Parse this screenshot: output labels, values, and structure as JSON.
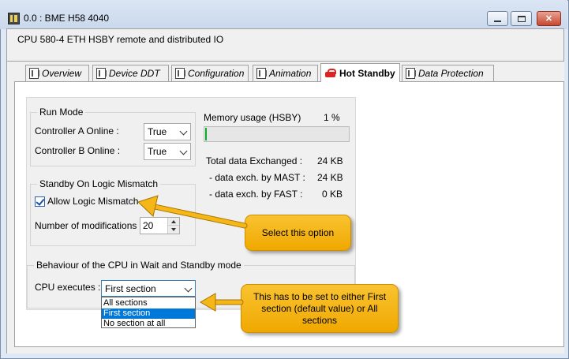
{
  "window": {
    "title": "0.0 : BME H58 4040",
    "minimize_icon": "minimize-icon",
    "maximize_icon": "maximize-icon",
    "close_icon": "close-icon"
  },
  "header": {
    "description": "CPU 580-4 ETH HSBY remote and distributed IO"
  },
  "tabs": [
    {
      "label": "Overview",
      "active": false
    },
    {
      "label": "Device DDT",
      "active": false
    },
    {
      "label": "Configuration",
      "active": false
    },
    {
      "label": "Animation",
      "active": false
    },
    {
      "label": "Hot Standby",
      "active": true
    },
    {
      "label": "Data Protection",
      "active": false
    }
  ],
  "run_mode": {
    "legend": "Run Mode",
    "controller_a_label": "Controller A Online :",
    "controller_a_value": "True",
    "controller_b_label": "Controller B Online :",
    "controller_b_value": "True"
  },
  "memory": {
    "label": "Memory usage (HSBY)",
    "value": "1 %",
    "fraction": 0.01,
    "bar_color": "#06b025"
  },
  "exchange": {
    "total_label": "Total data Exchanged :",
    "total_value": "24 KB",
    "mast_label": "- data exch. by MAST :",
    "mast_value": "24 KB",
    "fast_label": "- data exch. by FAST :",
    "fast_value": "0 KB"
  },
  "standby": {
    "legend": "Standby On Logic Mismatch",
    "allow_label": "Allow Logic Mismatch",
    "allow_checked": true,
    "modifications_label": "Number of modifications :",
    "modifications_value": "20"
  },
  "behaviour": {
    "legend": "Behaviour of the CPU in Wait and Standby mode",
    "executes_label": "CPU executes :",
    "executes_value": "First section",
    "options": [
      "All sections",
      "First section",
      "No section at all"
    ],
    "selected_index": 1
  },
  "annotations": {
    "callout_1": "Select this option",
    "callout_2": "This has to be set to either First section (default value) or All sections",
    "callout_color": "#f5b617"
  }
}
